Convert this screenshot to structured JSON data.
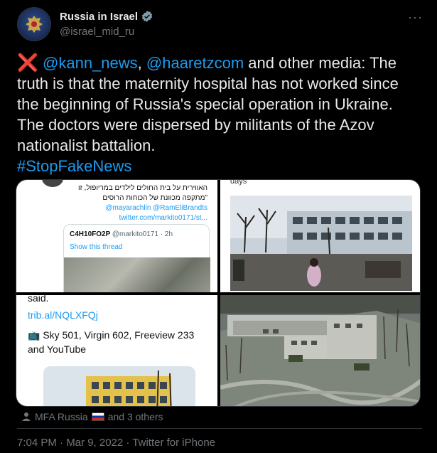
{
  "author": {
    "display_name": "Russia in Israel",
    "handle": "@israel_mid_ru",
    "verified_icon": "verified-badge-icon",
    "more_label": "···"
  },
  "tweet": {
    "x_icon": "❌",
    "mention1": "@kann_news",
    "sep1": ", ",
    "mention2": "@haaretzcom",
    "body": " and other media: The truth is that the maternity hospital has not worked since the beginning of Russia's special operation in Ukraine.  The doctors were dispersed by militants of the Azov nationalist battalion.",
    "hashtag": "#StopFakeNews"
  },
  "media": {
    "cell1": {
      "hebrew_line1": "האווירית על בית החולים לילדים במריופול, זו",
      "hebrew_line2": "\"מתקפה מכוונת של הכוחות הרוסים",
      "mentions": "@mayarachlin @RamEliBrandts",
      "link": "twitter.com/markito0171/st...",
      "quote_user": "C4H10FO2P",
      "quote_handle": "@markito0171 · 2h",
      "quote_thread": "Show this thread"
    },
    "cell2": {
      "top_text": "days"
    },
    "cell3": {
      "said": "said.",
      "link": "trib.al/NQLXFQj",
      "tv_text": "📺 Sky 501, Virgin 602, Freeview 233 and YouTube"
    }
  },
  "social": {
    "person_icon": "person-icon",
    "liked_by": "MFA Russia",
    "flag": "russia-flag",
    "others": "and 3 others"
  },
  "meta": {
    "timestamp": "7:04 PM · Mar 9, 2022 · Twitter for iPhone"
  },
  "colors": {
    "background": "#000000",
    "text": "#e7e9ea",
    "secondary": "#71767b",
    "link": "#1d9bf0"
  }
}
